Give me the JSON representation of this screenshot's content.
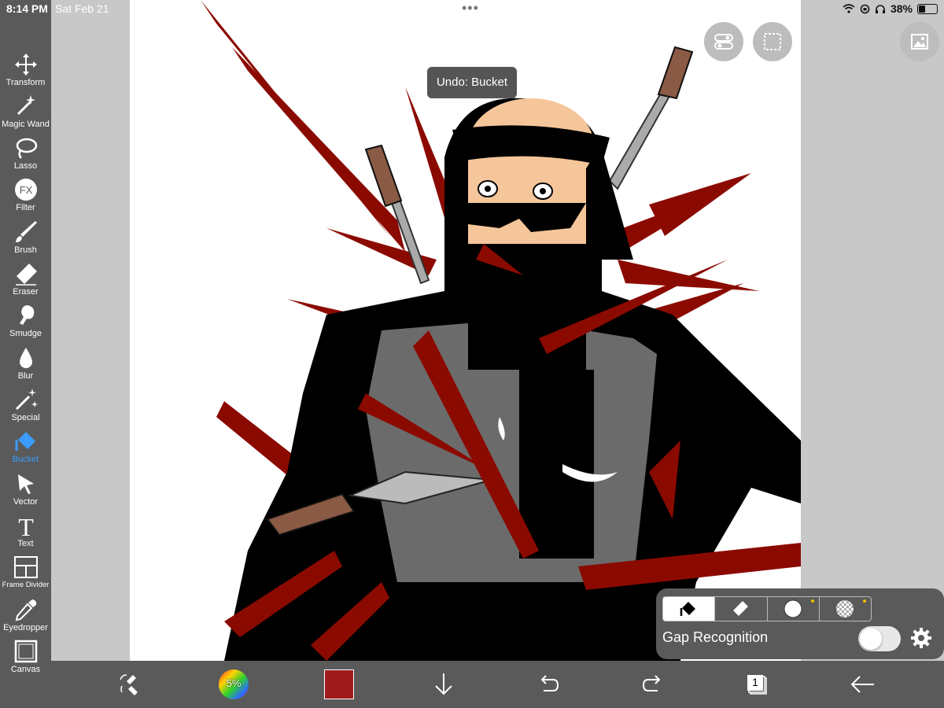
{
  "status_bar": {
    "time": "8:14 PM",
    "date": "Sat Feb 21",
    "battery": "38%"
  },
  "tools": [
    {
      "label": "Transform",
      "icon": "transform-icon"
    },
    {
      "label": "Magic Wand",
      "icon": "magic-wand-icon"
    },
    {
      "label": "Lasso",
      "icon": "lasso-icon"
    },
    {
      "label": "Filter",
      "icon": "filter-icon"
    },
    {
      "label": "Brush",
      "icon": "brush-icon"
    },
    {
      "label": "Eraser",
      "icon": "eraser-icon"
    },
    {
      "label": "Smudge",
      "icon": "smudge-icon"
    },
    {
      "label": "Blur",
      "icon": "blur-icon"
    },
    {
      "label": "Special",
      "icon": "special-icon"
    },
    {
      "label": "Bucket",
      "icon": "bucket-icon",
      "active": true
    },
    {
      "label": "Vector",
      "icon": "vector-icon"
    },
    {
      "label": "Text",
      "icon": "text-icon"
    },
    {
      "label": "Frame Divider",
      "icon": "frame-divider-icon"
    },
    {
      "label": "Eyedropper",
      "icon": "eyedropper-icon"
    },
    {
      "label": "Canvas",
      "icon": "canvas-icon"
    }
  ],
  "tooltip": "Undo: Bucket",
  "bottom_bar": {
    "color_wheel_label": "5%",
    "current_color": "#a01b1b",
    "layer_count": "1"
  },
  "bucket_panel": {
    "gap_recognition_label": "Gap Recognition",
    "gap_recognition_on": false
  },
  "colors": {
    "toolbar": "#5a5a5a",
    "active_tool": "#3b9cff",
    "ink_red": "#8b0a00"
  }
}
